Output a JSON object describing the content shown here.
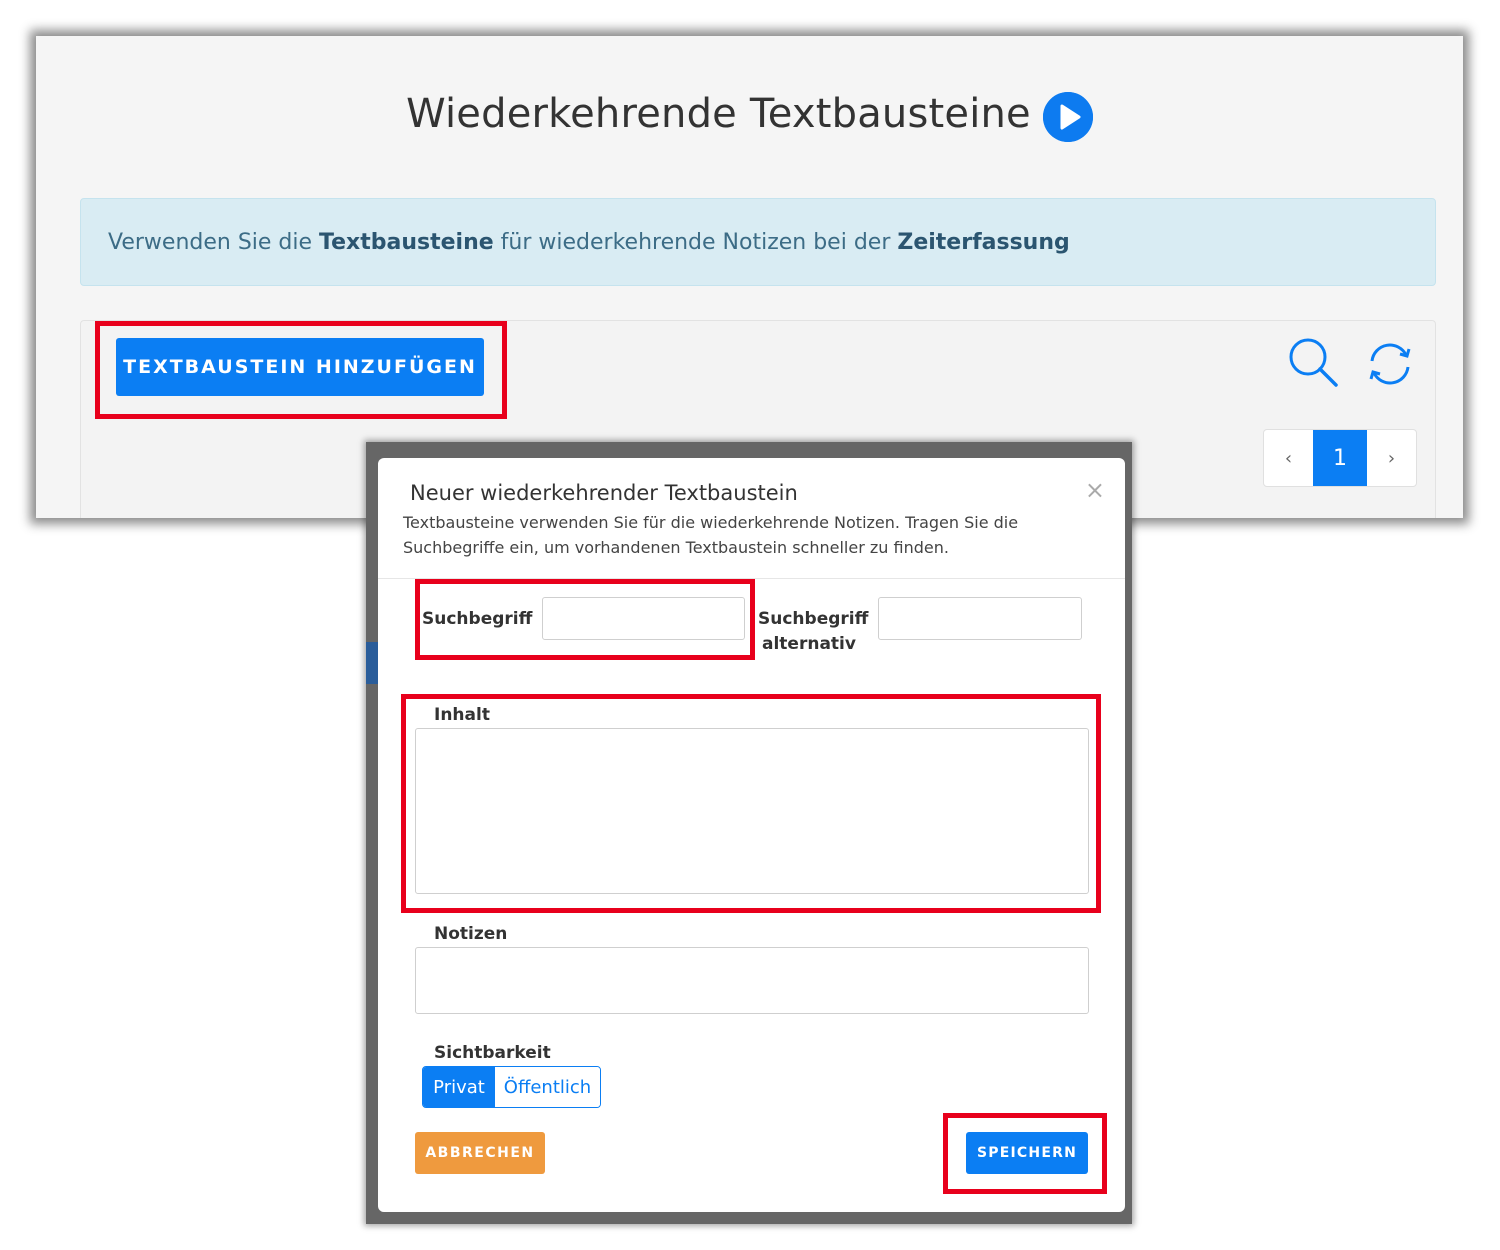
{
  "page": {
    "title": "Wiederkehrende Textbausteine",
    "info_before": "Verwenden Sie die ",
    "info_bold1": "Textbausteine",
    "info_middle": " für wiederkehrende Notizen bei der ",
    "info_bold2": "Zeiterfassung",
    "add_button": "TEXTBAUSTEIN HINZUFÜGEN",
    "pager": {
      "prev": "‹",
      "current": "1",
      "next": "›"
    }
  },
  "icons": [
    "play-icon",
    "search-icon",
    "refresh-icon",
    "close-icon",
    "resize-handle-icon"
  ],
  "modal": {
    "title": "Neuer wiederkehrender Textbaustein",
    "close": "×",
    "description": "Textbausteine verwenden Sie für die wiederkehrende Notizen. Tragen Sie die Suchbegriffe ein, um vorhandenen Textbaustein schneller zu finden.",
    "search_term_label": "Suchbegriff",
    "search_term_value": "",
    "alt_search_label_1": "Suchbegriff",
    "alt_search_label_2": "alternativ",
    "alt_search_value": "",
    "content_label": "Inhalt",
    "content_value": "",
    "notes_label": "Notizen",
    "notes_value": "",
    "visibility_label": "Sichtbarkeit",
    "visibility_options": [
      "Privat",
      "Öffentlich"
    ],
    "visibility_selected": "Privat",
    "cancel_button": "ABBRECHEN",
    "save_button": "SPEICHERN"
  },
  "colors": {
    "primary": "#0b7ef3",
    "cancel": "#ef9a3e",
    "highlight": "#e8001c",
    "info_bg": "#d9ecf3"
  }
}
